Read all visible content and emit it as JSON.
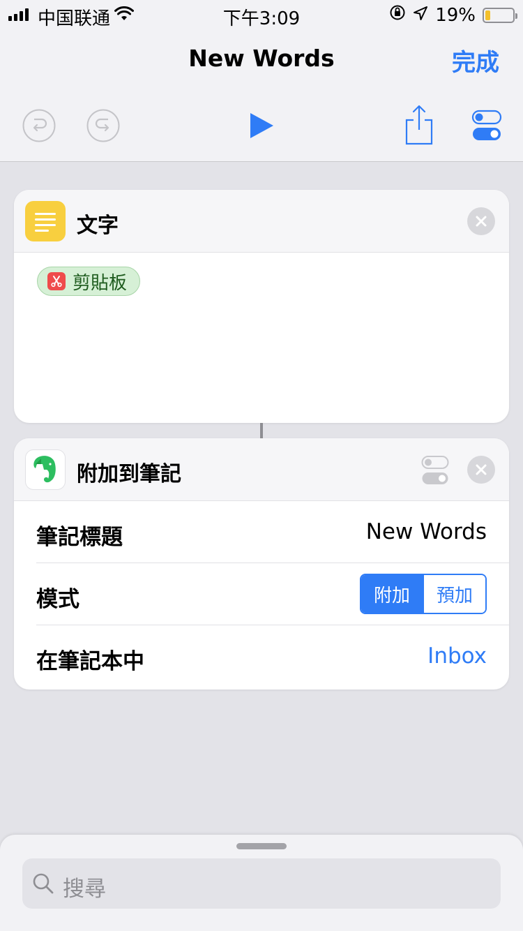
{
  "status_bar": {
    "carrier": "中国联通",
    "time": "下午3:09",
    "battery_percent": "19%",
    "battery_level": 0.19,
    "icons": [
      "signal-icon",
      "wifi-icon",
      "orientation-lock-icon",
      "location-icon",
      "battery-icon"
    ]
  },
  "nav": {
    "title": "New Words",
    "done_label": "完成",
    "toolbar_icons": [
      "undo-icon",
      "redo-icon",
      "play-icon",
      "share-icon",
      "settings-toggle-icon"
    ]
  },
  "actions": [
    {
      "title": "文字",
      "icon": "text-lines-icon",
      "icon_color": "#f8cf3f",
      "variable_chip": {
        "label": "剪貼板",
        "icon": "clipboard-scissors-icon"
      }
    },
    {
      "title": "附加到筆記",
      "icon": "evernote-elephant-icon",
      "params": {
        "note_title_label": "筆記標題",
        "note_title_value": "New Words",
        "mode_label": "模式",
        "mode_options": [
          "附加",
          "預加"
        ],
        "mode_selected": "附加",
        "notebook_label": "在筆記本中",
        "notebook_value": "Inbox"
      }
    }
  ],
  "search": {
    "placeholder": "搜尋"
  },
  "colors": {
    "accent": "#2f7cf6",
    "background": "#e3e3e8",
    "text_icon": "#f8cf3f",
    "evernote_green": "#2dbe60",
    "chip_green": "#d6f0d6"
  }
}
